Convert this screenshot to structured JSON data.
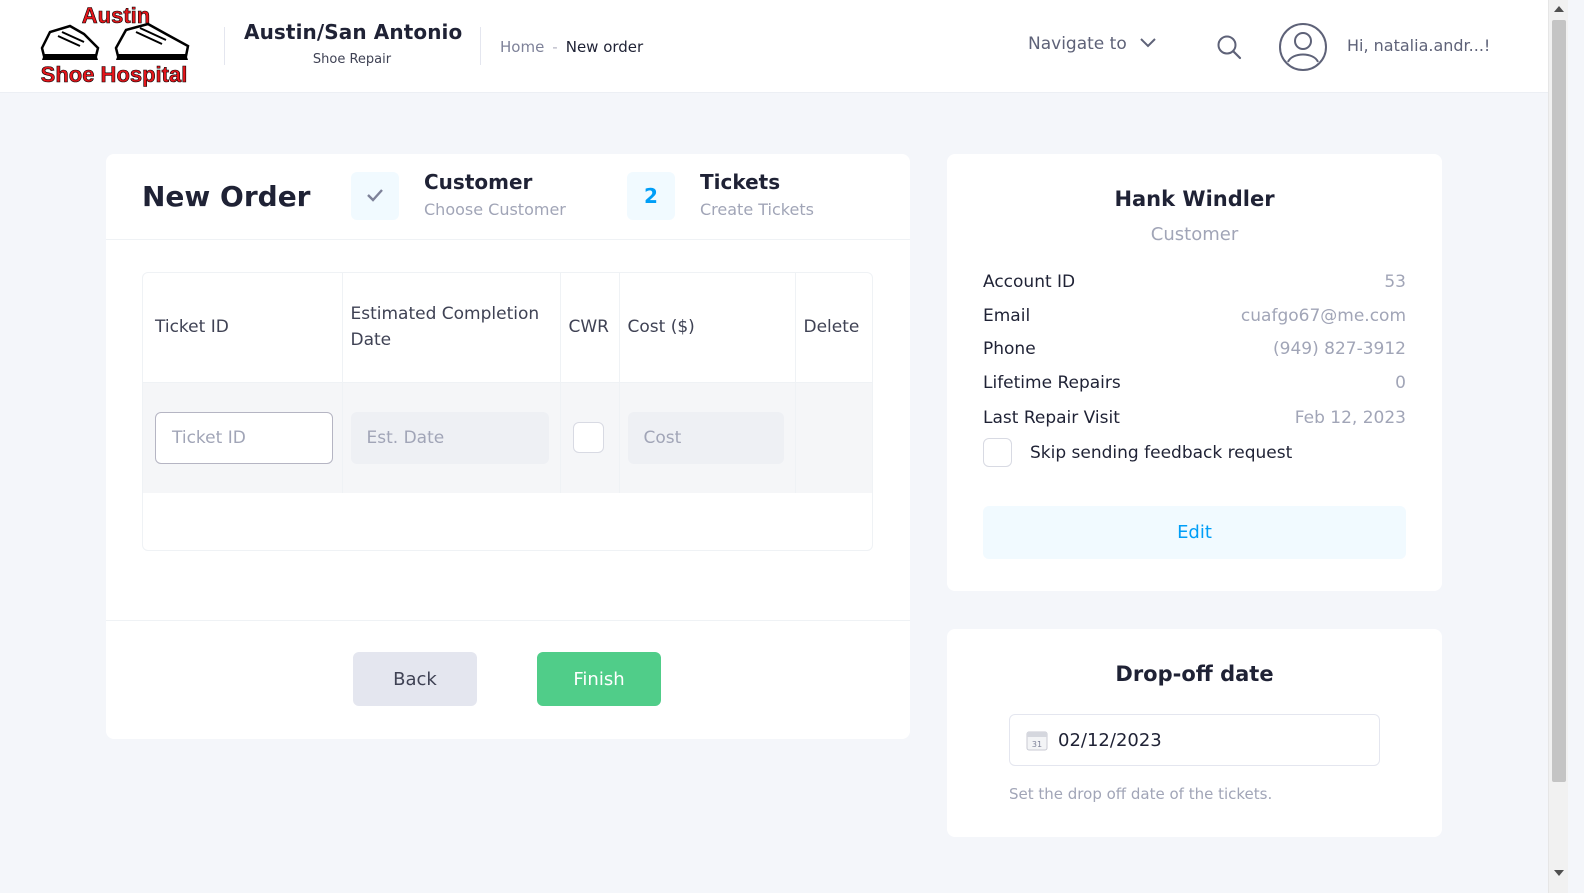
{
  "header": {
    "logo_line1": "Austin",
    "logo_line2": "Shoe Hospital",
    "brand_title": "Austin/San Antonio",
    "brand_subtitle": "Shoe Repair",
    "breadcrumb_home": "Home",
    "breadcrumb_separator": "-",
    "breadcrumb_current": "New order",
    "navigate_label": "Navigate to",
    "greeting": "Hi, natalia.andr...!",
    "icons": [
      "search-icon",
      "user-avatar-icon",
      "chevron-down-icon"
    ]
  },
  "order": {
    "title": "New Order",
    "steps": [
      {
        "number": "",
        "title": "Customer",
        "description": "Choose Customer",
        "state": "completed"
      },
      {
        "number": "2",
        "title": "Tickets",
        "description": "Create Tickets",
        "state": "current"
      }
    ],
    "table": {
      "headers": [
        "Ticket ID",
        "Estimated Completion Date",
        "CWR",
        "Cost ($)",
        "Delete"
      ],
      "row": {
        "ticket_placeholder": "Ticket ID",
        "date_placeholder": "Est. Date",
        "cost_placeholder": "Cost"
      }
    },
    "back_label": "Back",
    "finish_label": "Finish"
  },
  "customer": {
    "name": "Hank Windler",
    "role": "Customer",
    "fields": [
      {
        "label": "Account ID",
        "value": "53"
      },
      {
        "label": "Email",
        "value": "cuafgo67@me.com"
      },
      {
        "label": "Phone",
        "value": "(949) 827-3912"
      },
      {
        "label": "Lifetime Repairs",
        "value": "0"
      },
      {
        "label": "Last Repair Visit",
        "value": "Feb 12, 2023"
      }
    ],
    "skip_label": "Skip sending feedback request",
    "edit_label": "Edit"
  },
  "dropoff": {
    "title": "Drop-off date",
    "date_value": "02/12/2023",
    "calendar_day": "31",
    "help_text": "Set the drop off date of the tickets."
  },
  "colors": {
    "primary": "#009ef7",
    "success": "#50cd89",
    "logo_red": "#e4161b",
    "muted": "#a1a5b7"
  }
}
